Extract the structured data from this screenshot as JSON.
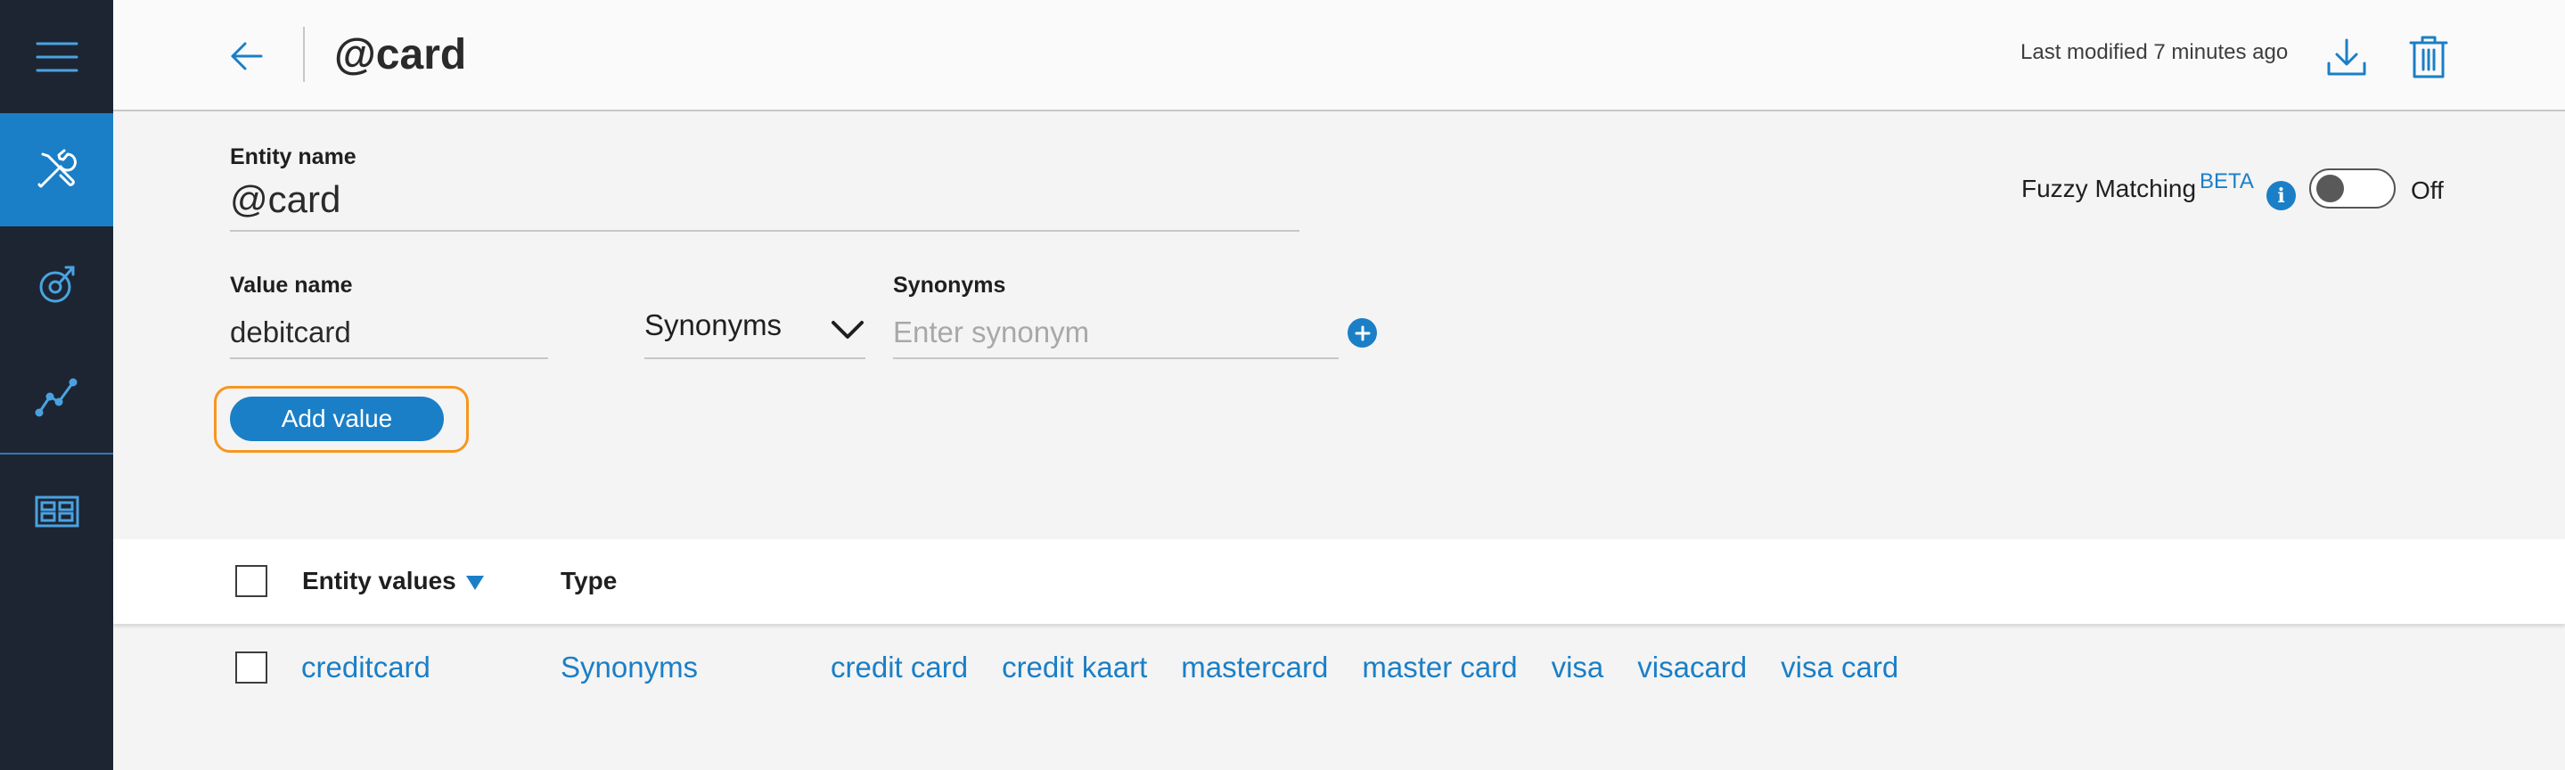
{
  "sidebar": {
    "items": [
      {
        "icon": "menu-icon"
      },
      {
        "icon": "tools-icon",
        "active": true
      },
      {
        "icon": "deploy-icon"
      },
      {
        "icon": "analytics-icon"
      },
      {
        "icon": "dashboard-icon"
      }
    ]
  },
  "header": {
    "title": "@card",
    "last_modified": "Last modified 7 minutes ago"
  },
  "form": {
    "entity_name_label": "Entity name",
    "entity_name_value": "@card",
    "fuzzy_label": "Fuzzy Matching",
    "fuzzy_beta": "BETA",
    "info_symbol": "i",
    "fuzzy_state": "Off",
    "value_name_label": "Value name",
    "value_name_value": "debitcard",
    "type_selected": "Synonyms",
    "synonyms_label": "Synonyms",
    "synonym_placeholder": "Enter synonym",
    "add_value_label": "Add value"
  },
  "table": {
    "headers": {
      "entity_values": "Entity values",
      "type": "Type"
    },
    "rows": [
      {
        "value": "creditcard",
        "type": "Synonyms",
        "synonyms": [
          "credit card",
          "credit kaart",
          "mastercard",
          "master card",
          "visa",
          "visacard",
          "visa card"
        ]
      }
    ]
  },
  "colors": {
    "accent": "#1a7fc7",
    "sidebar_bg": "#1d2533",
    "highlight_outline": "#f7961e"
  }
}
